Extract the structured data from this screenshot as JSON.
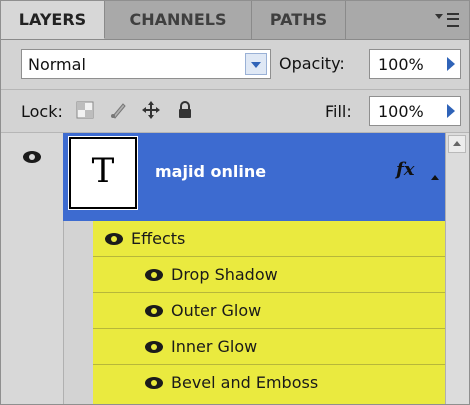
{
  "tabs": [
    {
      "label": "LAYERS"
    },
    {
      "label": "CHANNELS"
    },
    {
      "label": "PATHS"
    }
  ],
  "blend_mode": {
    "value": "Normal"
  },
  "opacity": {
    "label": "Opacity:",
    "value": "100%"
  },
  "lock": {
    "label": "Lock:"
  },
  "fill": {
    "label": "Fill:",
    "value": "100%"
  },
  "layer": {
    "thumb_letter": "T",
    "name": "majid online",
    "fx_label": "fx"
  },
  "effects": {
    "header": "Effects",
    "items": [
      "Drop Shadow",
      "Outer Glow",
      "Inner Glow",
      "Bevel and Emboss"
    ]
  },
  "colors": {
    "selected_row": "#3d6bd0",
    "effects_highlight": "#eaea3f",
    "accent_arrow": "#2f63b8"
  },
  "icons": [
    "panel-menu-icon",
    "dropdown-arrow-icon",
    "lock-transparent-icon",
    "lock-brush-icon",
    "lock-move-icon",
    "lock-all-icon",
    "visibility-eye-icon",
    "fx-icon",
    "expand-triangle-icon"
  ]
}
